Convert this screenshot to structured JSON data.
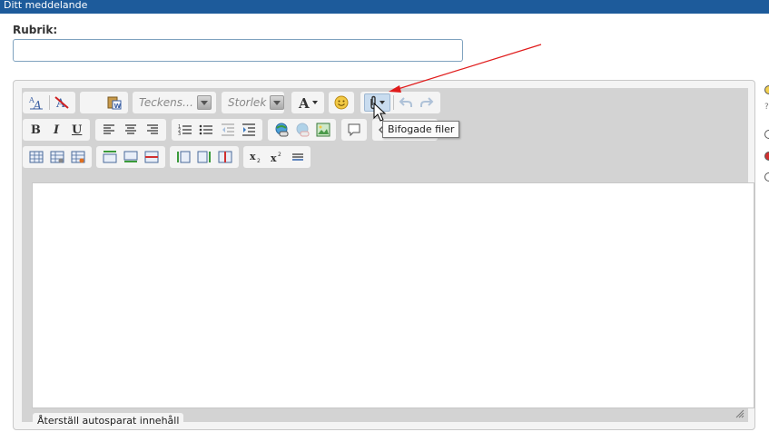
{
  "header": {
    "title": "Ditt meddelande"
  },
  "subject": {
    "label": "Rubrik:",
    "value": ""
  },
  "toolbar": {
    "font_placeholder": "Teckens…",
    "size_placeholder": "Storlek",
    "tooltip": "Bifogade filer",
    "icons": {
      "remove_format": "remove-format-icon",
      "attach": "paperclip-icon"
    }
  },
  "editor": {
    "autosave_label": "Återställ autosparat innehåll"
  },
  "colors": {
    "header_bg": "#1d5b9b",
    "arrow": "#e01b1b",
    "input_border": "#7fa2bf"
  }
}
